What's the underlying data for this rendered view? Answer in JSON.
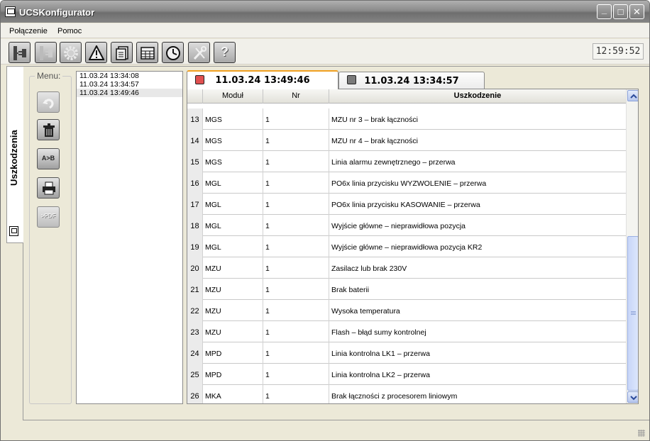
{
  "window": {
    "title": "UCSKonfigurator",
    "controls": {
      "minimize": "_",
      "maximize": "□",
      "close": "✕"
    }
  },
  "menu": [
    {
      "label": "Połączenie"
    },
    {
      "label": "Pomoc"
    }
  ],
  "toolbar": {
    "icons": [
      "connect-plug-icon",
      "disconnect-plug-icon",
      "settings-gear-icon",
      "warning-icon",
      "documents-icon",
      "table-icon",
      "clock-icon",
      "tools-icon",
      "help-icon"
    ],
    "help_glyph": "?",
    "clock": "12:59:52"
  },
  "side_tab": {
    "label": "Uszkodzenia"
  },
  "menu_panel": {
    "legend": "Menu:",
    "buttons": [
      "undo-icon",
      "delete-icon",
      "compare-icon",
      "print-icon",
      "pdf-icon"
    ],
    "compare_text": "A>B",
    "pdf_text": ">PDF"
  },
  "date_list": [
    {
      "label": "11.03.24 13:34:08"
    },
    {
      "label": "11.03.24 13:34:57"
    },
    {
      "label": "11.03.24 13:49:46"
    }
  ],
  "tabs": [
    {
      "label": "11.03.24 13:49:46",
      "active": true
    },
    {
      "label": "11.03.24 13:34:57",
      "active": false
    }
  ],
  "grid": {
    "columns": [
      "",
      "Moduł",
      "Nr",
      "Uszkodzenie"
    ],
    "rows": [
      {
        "n": "13",
        "modul": "MGS",
        "nr": "1",
        "desc": "MZU nr 3 – brak łączności"
      },
      {
        "n": "14",
        "modul": "MGS",
        "nr": "1",
        "desc": "MZU nr 4 – brak łączności"
      },
      {
        "n": "15",
        "modul": "MGS",
        "nr": "1",
        "desc": "Linia  alarmu zewnętrznego – przerwa"
      },
      {
        "n": "16",
        "modul": "MGL",
        "nr": "1",
        "desc": "PO6x linia przycisku WYZWOLENIE – przerwa"
      },
      {
        "n": "17",
        "modul": "MGL",
        "nr": "1",
        "desc": "PO6x linia przycisku KASOWANIE – przerwa"
      },
      {
        "n": "18",
        "modul": "MGL",
        "nr": "1",
        "desc": "Wyjście główne – nieprawidłowa pozycja"
      },
      {
        "n": "19",
        "modul": "MGL",
        "nr": "1",
        "desc": "Wyjście główne – nieprawidłowa pozycja KR2"
      },
      {
        "n": "20",
        "modul": "MZU",
        "nr": "1",
        "desc": "Zasilacz lub brak 230V"
      },
      {
        "n": "21",
        "modul": "MZU",
        "nr": "1",
        "desc": "Brak baterii"
      },
      {
        "n": "22",
        "modul": "MZU",
        "nr": "1",
        "desc": "Wysoka temperatura"
      },
      {
        "n": "23",
        "modul": "MZU",
        "nr": "1",
        "desc": "Flash – błąd sumy kontrolnej"
      },
      {
        "n": "24",
        "modul": "MPD",
        "nr": "1",
        "desc": "Linia kontrolna LK1 – przerwa"
      },
      {
        "n": "25",
        "modul": "MPD",
        "nr": "1",
        "desc": "Linia kontrolna LK2 – przerwa"
      },
      {
        "n": "26",
        "modul": "MKA",
        "nr": "1",
        "desc": "Brak łączności z procesorem liniowym"
      }
    ]
  },
  "colors": {
    "tab_accent": "#f0a020",
    "scroll_blue": "#b8c8ee"
  }
}
